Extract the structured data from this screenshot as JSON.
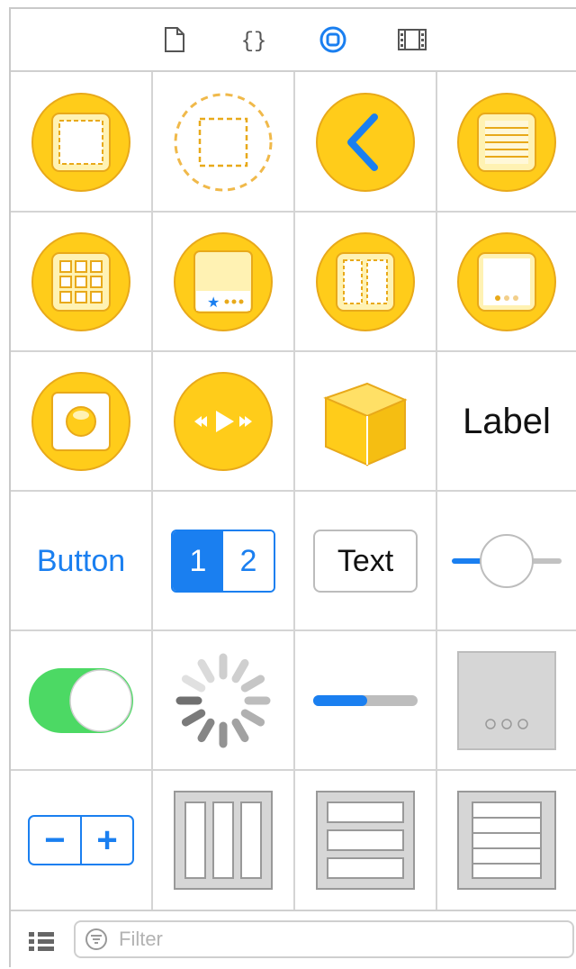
{
  "toolbar": {
    "icons": [
      "file-inspector-icon",
      "quick-help-icon",
      "object-library-icon",
      "media-library-icon"
    ],
    "active_index": 2
  },
  "library": {
    "items": [
      {
        "name": "view-controller"
      },
      {
        "name": "storyboard-reference"
      },
      {
        "name": "navigation-controller"
      },
      {
        "name": "table-view-controller"
      },
      {
        "name": "collection-view-controller"
      },
      {
        "name": "tab-bar-controller"
      },
      {
        "name": "split-view-controller"
      },
      {
        "name": "page-view-controller"
      },
      {
        "name": "glkit-view-controller"
      },
      {
        "name": "avkit-player-view-controller"
      },
      {
        "name": "object"
      },
      {
        "name": "label",
        "text": "Label"
      },
      {
        "name": "button",
        "text": "Button"
      },
      {
        "name": "segmented-control",
        "seg1": "1",
        "seg2": "2"
      },
      {
        "name": "text-field",
        "text": "Text"
      },
      {
        "name": "slider"
      },
      {
        "name": "switch"
      },
      {
        "name": "activity-indicator"
      },
      {
        "name": "progress-view"
      },
      {
        "name": "page-control"
      },
      {
        "name": "stepper",
        "minus": "−",
        "plus": "+"
      },
      {
        "name": "horizontal-stack-view"
      },
      {
        "name": "vertical-stack-view"
      },
      {
        "name": "table-view"
      }
    ]
  },
  "footer": {
    "filter_placeholder": "Filter"
  },
  "colors": {
    "yellow": "#FFCC1A",
    "yellow_dark": "#E8A91A",
    "blue": "#1A7FF0",
    "green": "#4CD964",
    "gray": "#D6D6D6"
  }
}
